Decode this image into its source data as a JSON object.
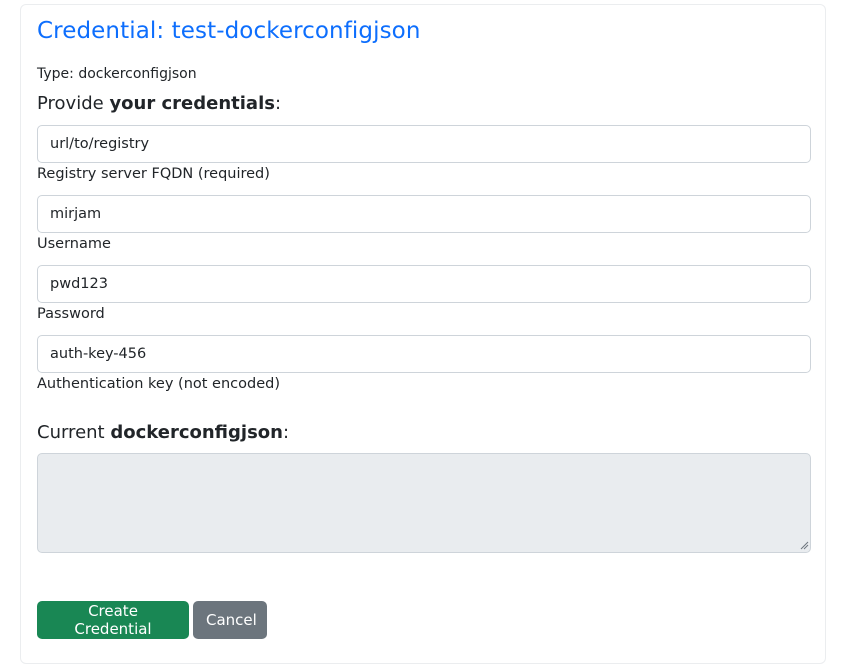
{
  "title": "Credential: test-dockerconfigjson",
  "type_line": "Type: dockerconfigjson",
  "provide_heading": {
    "prefix": "Provide ",
    "bold": "your credentials",
    "suffix": ":"
  },
  "fields": {
    "registry": {
      "value": "url/to/registry",
      "help": "Registry server FQDN (required)"
    },
    "username": {
      "value": "mirjam",
      "help": "Username"
    },
    "password": {
      "value": "pwd123",
      "help": "Password"
    },
    "auth_key": {
      "value": "auth-key-456",
      "help": "Authentication key (not encoded)"
    }
  },
  "current_heading": {
    "prefix": "Current ",
    "bold": "dockerconfigjson",
    "suffix": ":"
  },
  "current_value": "",
  "buttons": {
    "create": "Create Credential",
    "cancel": "Cancel"
  },
  "colors": {
    "title": "#0d6efd",
    "create": "#198754",
    "cancel": "#6c757d",
    "readonly_bg": "#e9ecef"
  }
}
